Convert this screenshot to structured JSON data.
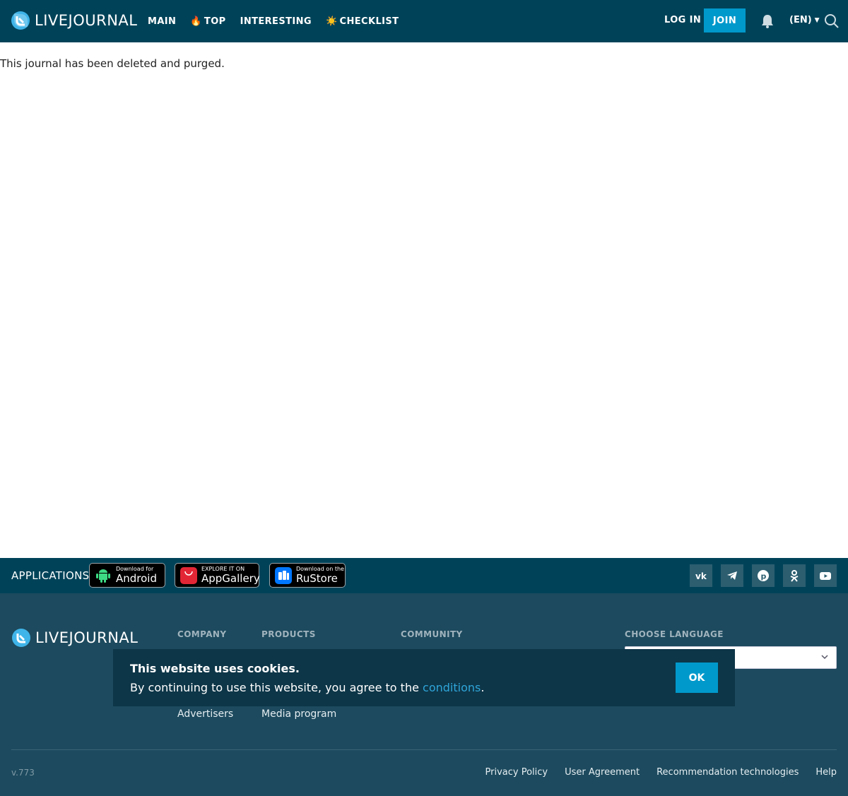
{
  "header": {
    "logo_text": "LIVEJOURNAL",
    "nav": [
      {
        "emoji": "",
        "label": "MAIN"
      },
      {
        "emoji": "🔥",
        "label": "TOP"
      },
      {
        "emoji": "",
        "label": "INTERESTING"
      },
      {
        "emoji": "☀️",
        "label": "CHECKLIST"
      }
    ],
    "login_label": "LOG IN",
    "join_label": "JOIN",
    "lang_label": "(EN)"
  },
  "main": {
    "message": "This journal has been deleted and purged."
  },
  "apps": {
    "label": "APPLICATIONS",
    "badges": [
      {
        "small": "Download for",
        "big": "Android"
      },
      {
        "small": "EXPLORE IT ON",
        "big": "AppGallery"
      },
      {
        "small": "Download on the",
        "big": "RuStore"
      }
    ],
    "social_icons": [
      "vk-icon",
      "telegram-icon",
      "pinterest-icon",
      "odnoklassniki-icon",
      "youtube-icon"
    ]
  },
  "footer": {
    "logo_text": "LIVEJOURNAL",
    "company_heading": "COMPANY",
    "products_heading": "PRODUCTS",
    "community_heading": "COMMUNITY",
    "language_heading": "CHOOSE LANGUAGE",
    "company_links": [
      "Advertisers"
    ],
    "products_links": [
      "Media program"
    ],
    "version": "v.773",
    "bottom_links": [
      "Privacy Policy",
      "User Agreement",
      "Recommendation technologies",
      "Help"
    ]
  },
  "cookie": {
    "title": "This website uses cookies.",
    "text_before": "By continuing to use this website, you agree to the ",
    "link_text": "conditions",
    "text_after": ".",
    "ok_label": "OK"
  },
  "colors": {
    "header_bg": "#004359",
    "accent": "#0099cc",
    "footer_bg": "#1d4a5e",
    "cookie_bg": "#0d3648"
  }
}
